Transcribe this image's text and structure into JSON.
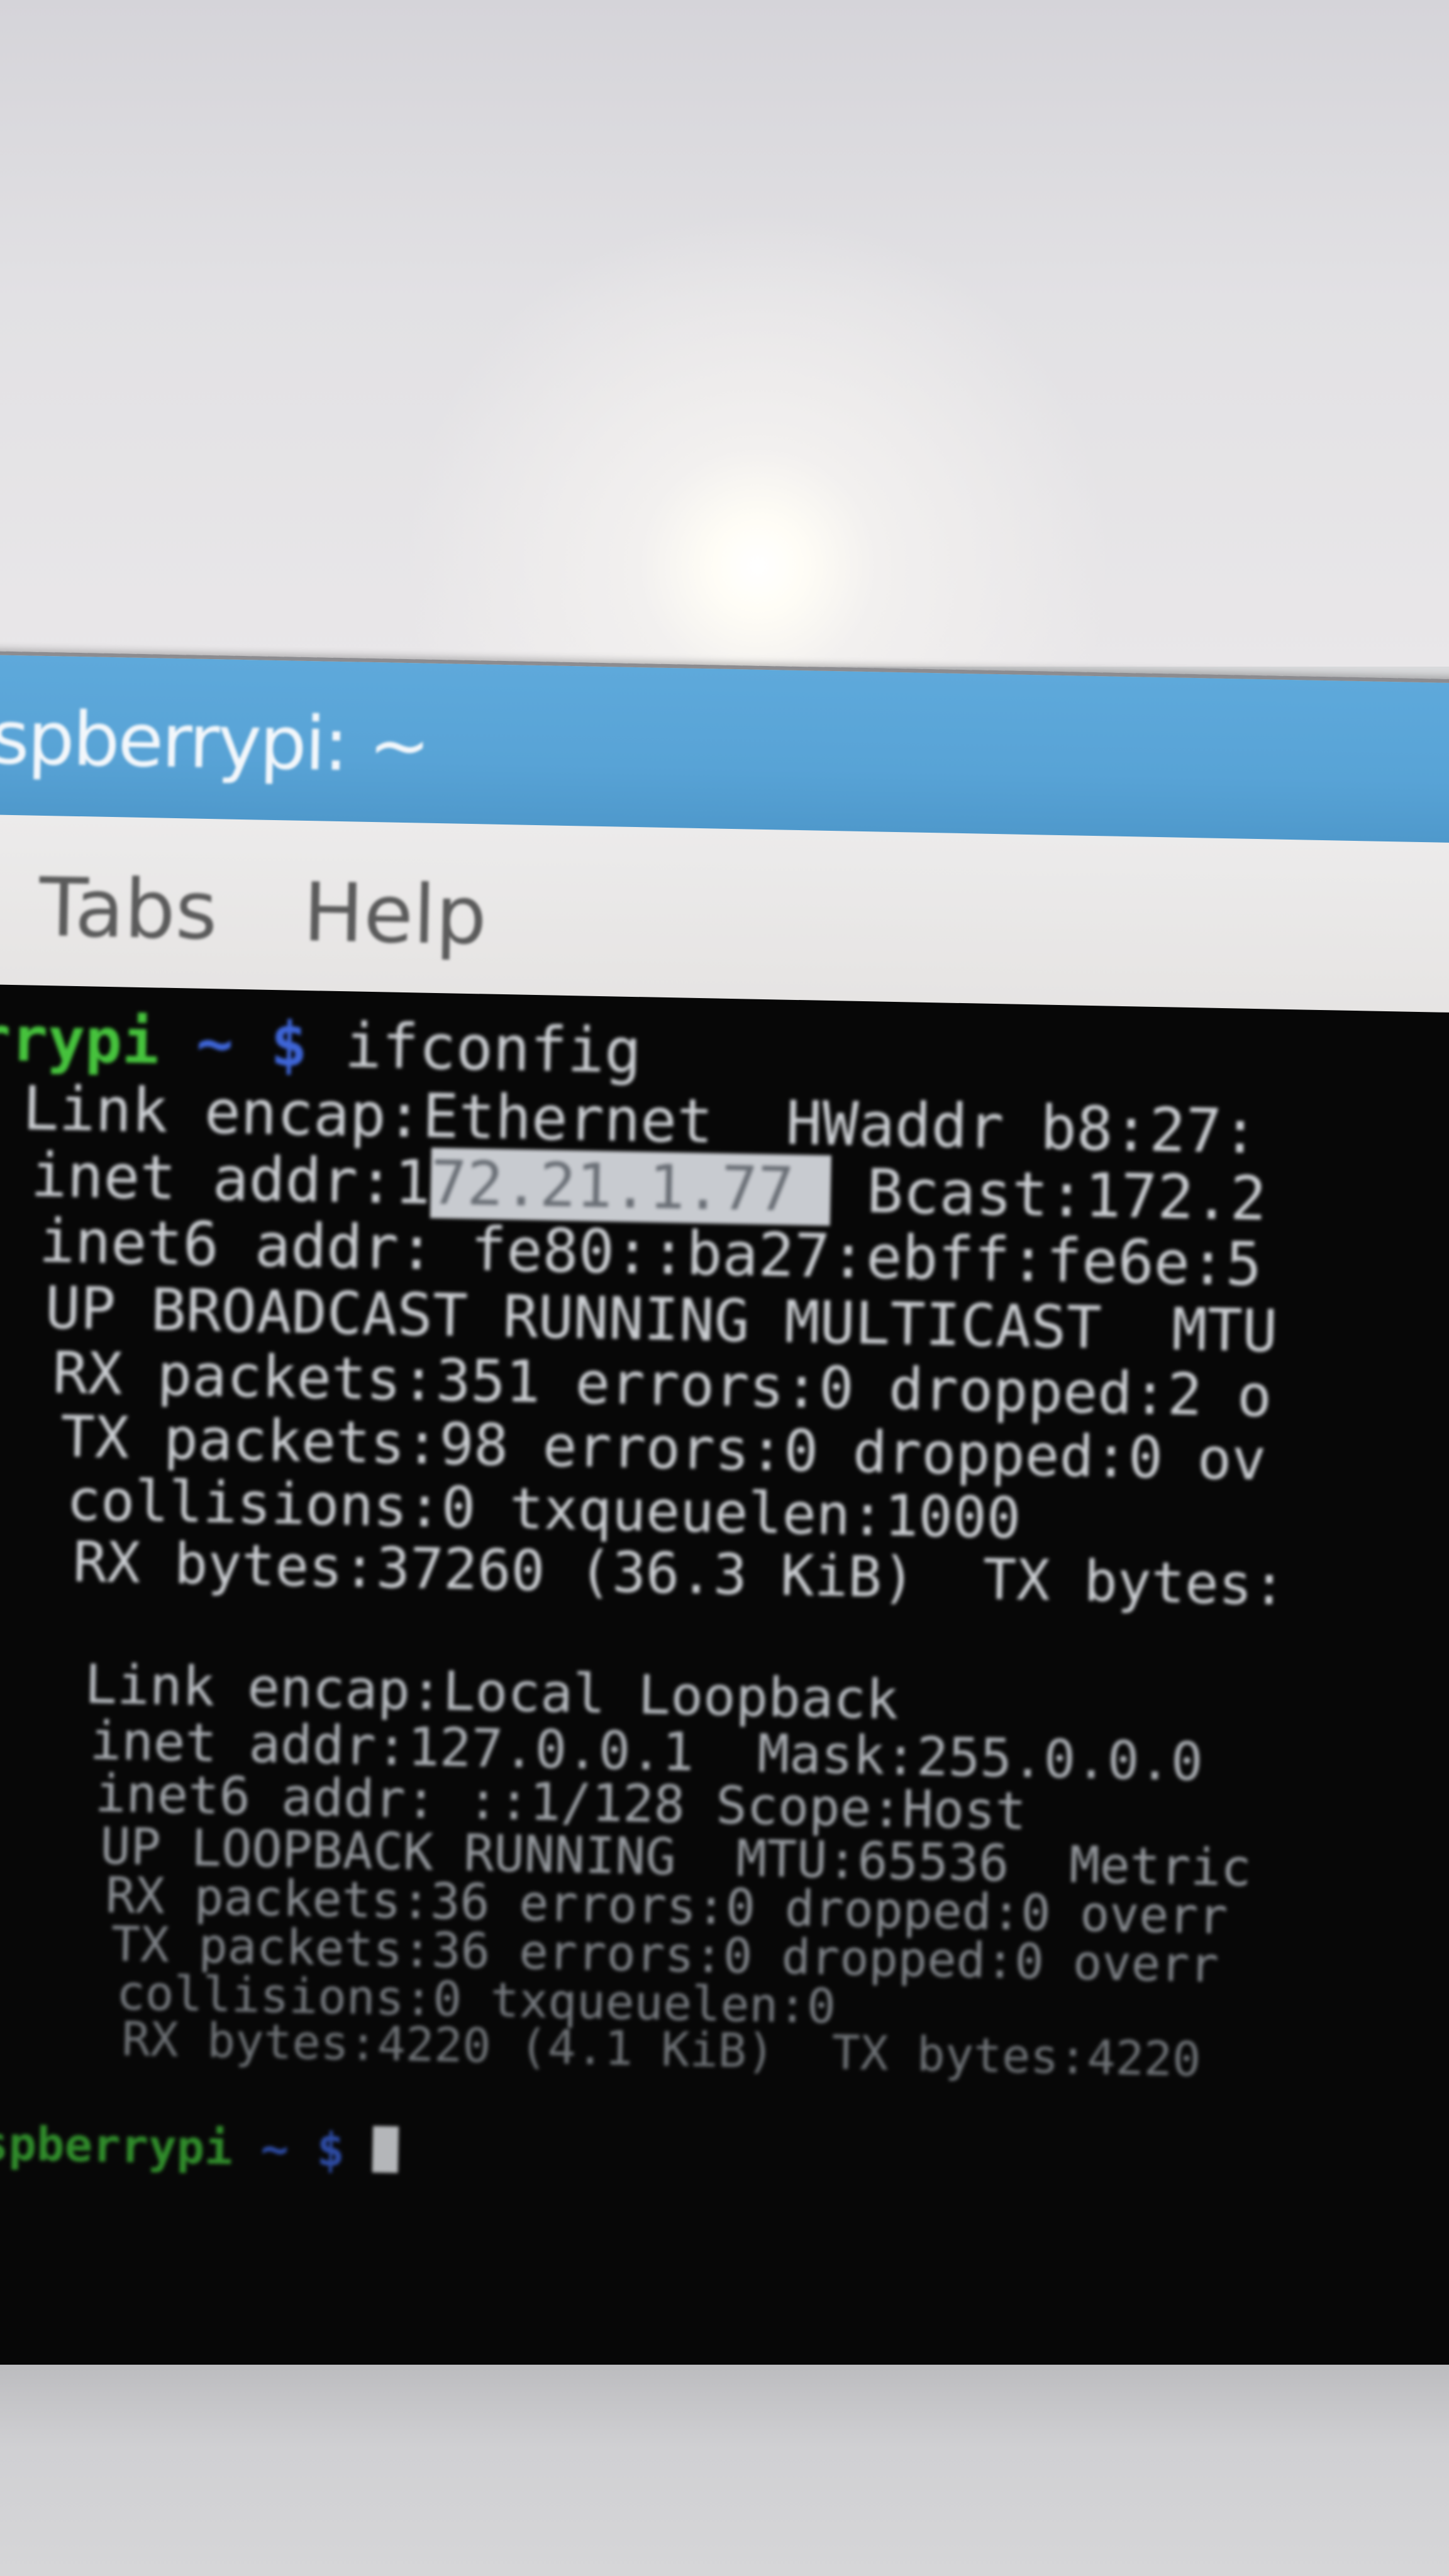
{
  "window": {
    "title": "spberrypi: ~",
    "menu": [
      "Tabs",
      "Help"
    ]
  },
  "terminal": {
    "prompt1_user": "rrypi",
    "prompt1_path": " ~ $",
    "command": " ifconfig",
    "lines": [
      "Link encap:Ethernet  HWaddr b8:27:",
      "inet addr:1",
      "72.21.1.77 ",
      " Bcast:172.2",
      "inet6 addr: fe80::ba27:ebff:fe6e:5",
      "UP BROADCAST RUNNING MULTICAST  MTU",
      "RX packets:351 errors:0 dropped:2 o",
      "TX packets:98 errors:0 dropped:0 ov",
      "collisions:0 txqueuelen:1000",
      "RX bytes:37260 (36.3 KiB)  TX bytes:",
      "Link encap:Local Loopback",
      "inet addr:127.0.0.1  Mask:255.0.0.0",
      "inet6 addr: ::1/128 Scope:Host",
      "UP LOOPBACK RUNNING  MTU:65536  Metric",
      "RX packets:36 errors:0 dropped:0 overr",
      "TX packets:36 errors:0 dropped:0 overr",
      "collisions:0 txqueuelen:0",
      "RX bytes:4220 (4.1 KiB)  TX bytes:4220"
    ],
    "prompt2_user": "aspberrypi",
    "prompt2_path": " ~ $ "
  },
  "colors": {
    "titlebar": "#58a3d6",
    "terminal_bg": "#070707",
    "prompt_user": "#45c23c",
    "prompt_path": "#3d64d6",
    "text": "#c9ccd0",
    "selection": "#c8cbd0"
  }
}
